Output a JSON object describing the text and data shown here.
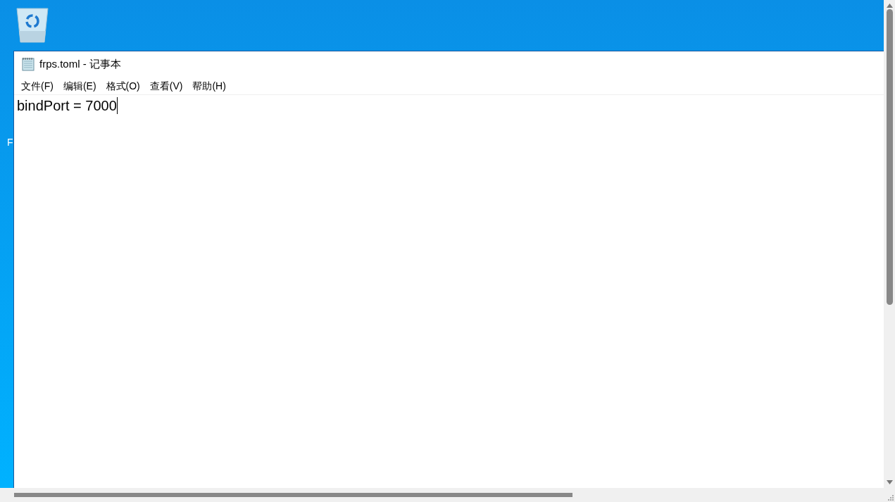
{
  "desktop": {
    "icon_label": "F"
  },
  "window": {
    "title": "frps.toml - 记事本"
  },
  "menu": [
    "文件(F)",
    "编辑(E)",
    "格式(O)",
    "查看(V)",
    "帮助(H)"
  ],
  "editor": {
    "content": "bindPort = 7000"
  }
}
